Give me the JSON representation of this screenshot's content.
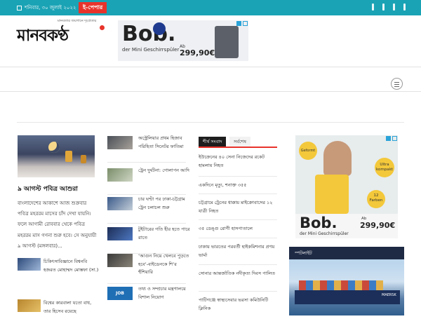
{
  "topbar": {
    "date": "শনিবার, ৩০ জুলাই ২০২২",
    "epaper": "ই-পেপার"
  },
  "logo": {
    "name": "মানবকণ্ঠ",
    "tagline": "মানবতার জয়গানে দৃঢ়প্রত্যয়"
  },
  "ad_top": {
    "brand": "Bob.",
    "sub": "der Mini Geschirrspüler",
    "ab": "Ab",
    "price": "299,90€"
  },
  "hero": {
    "title": "৯ আগস্ট পবিত্র আশুরা",
    "text": "বাংলাদেশের আকাশে আজ শুক্রবার পবিত্র মহররম মাসের চাঁদ দেখা যায়নি। ফলে আগামী রোববার থেকে পবিত্র মহররম মাস গণনা শুরু হবে। সে অনুযায়ী ৯ আগস্ট (মঙ্গলবার)..."
  },
  "left_minis": [
    {
      "text": "চিকিৎসাবিজ্ঞানে বিশ্বনবি হজরত মোহাম্মদ মোস্তফা (সা.)"
    },
    {
      "text": "বিশ্বের কারবালা যতো বাধ, তার হিসেব রয়েছে"
    }
  ],
  "col2": [
    {
      "text": "অস্ট্রেলিয়ার প্রথম হিজাব পরিহিতা সিনেটর ফাতিমা"
    },
    {
      "text": "ট্রেন দুর্ঘটনা: গোলাপন আদি"
    },
    {
      "text": "চার ঘণ্টা পর ঢাকা-চট্টগ্রাম ট্রেন চলাচল শুরু"
    },
    {
      "text": "টুইটারের গতি হীর হতে পারে রাতে"
    },
    {
      "text": "‘আগুন নিয়ে খেলবে পুড়তে হবে’-বাইডেনকে শি’র হুঁশিয়ারি"
    },
    {
      "text": "তথ্য ও সম্প্রচার মন্ত্রণালয়ে বিশাল নিয়োগ",
      "thumb_label": "JOB"
    }
  ],
  "tabs": {
    "active": "শীর্ষ সংবাদ",
    "other": "সর্বশেষ"
  },
  "news_list": [
    "ইউক্রেনের ৪০ সেনা নিজেদের রকেট হামলায় নিহত",
    "একদিনে মৃত্যু, শনাক্ত ৩৫৫",
    "চট্টগ্রামে ট্রেনের ধাক্কায় মাইক্রোবাসের ১২ যাত্রী নিহত",
    "৩৫ ডেঙ্গু রোগী হাসপাতালে",
    "ঢাকায় ভারতের পরবর্তী হাইকমিশনার প্রণয় ভার্মা",
    "সোনার আন্তর্জাতিক নদীকৃত্য দিবস পালিত",
    "পাটিগঞ্জে স্বাস্থ্যসেবার ভরসা কমিউনিটি ক্লিনিক"
  ],
  "ad_side": {
    "badge1": "Geformt",
    "badge2": "Ultra kompakt",
    "badge3": "12 Farben",
    "brand": "Bob.",
    "sub": "der Mini Geschirrspüler",
    "ab": "Ab",
    "price": "299,90€"
  },
  "spotlight": {
    "label": "স্পটলাইট",
    "image_brand": "MAERSK"
  }
}
